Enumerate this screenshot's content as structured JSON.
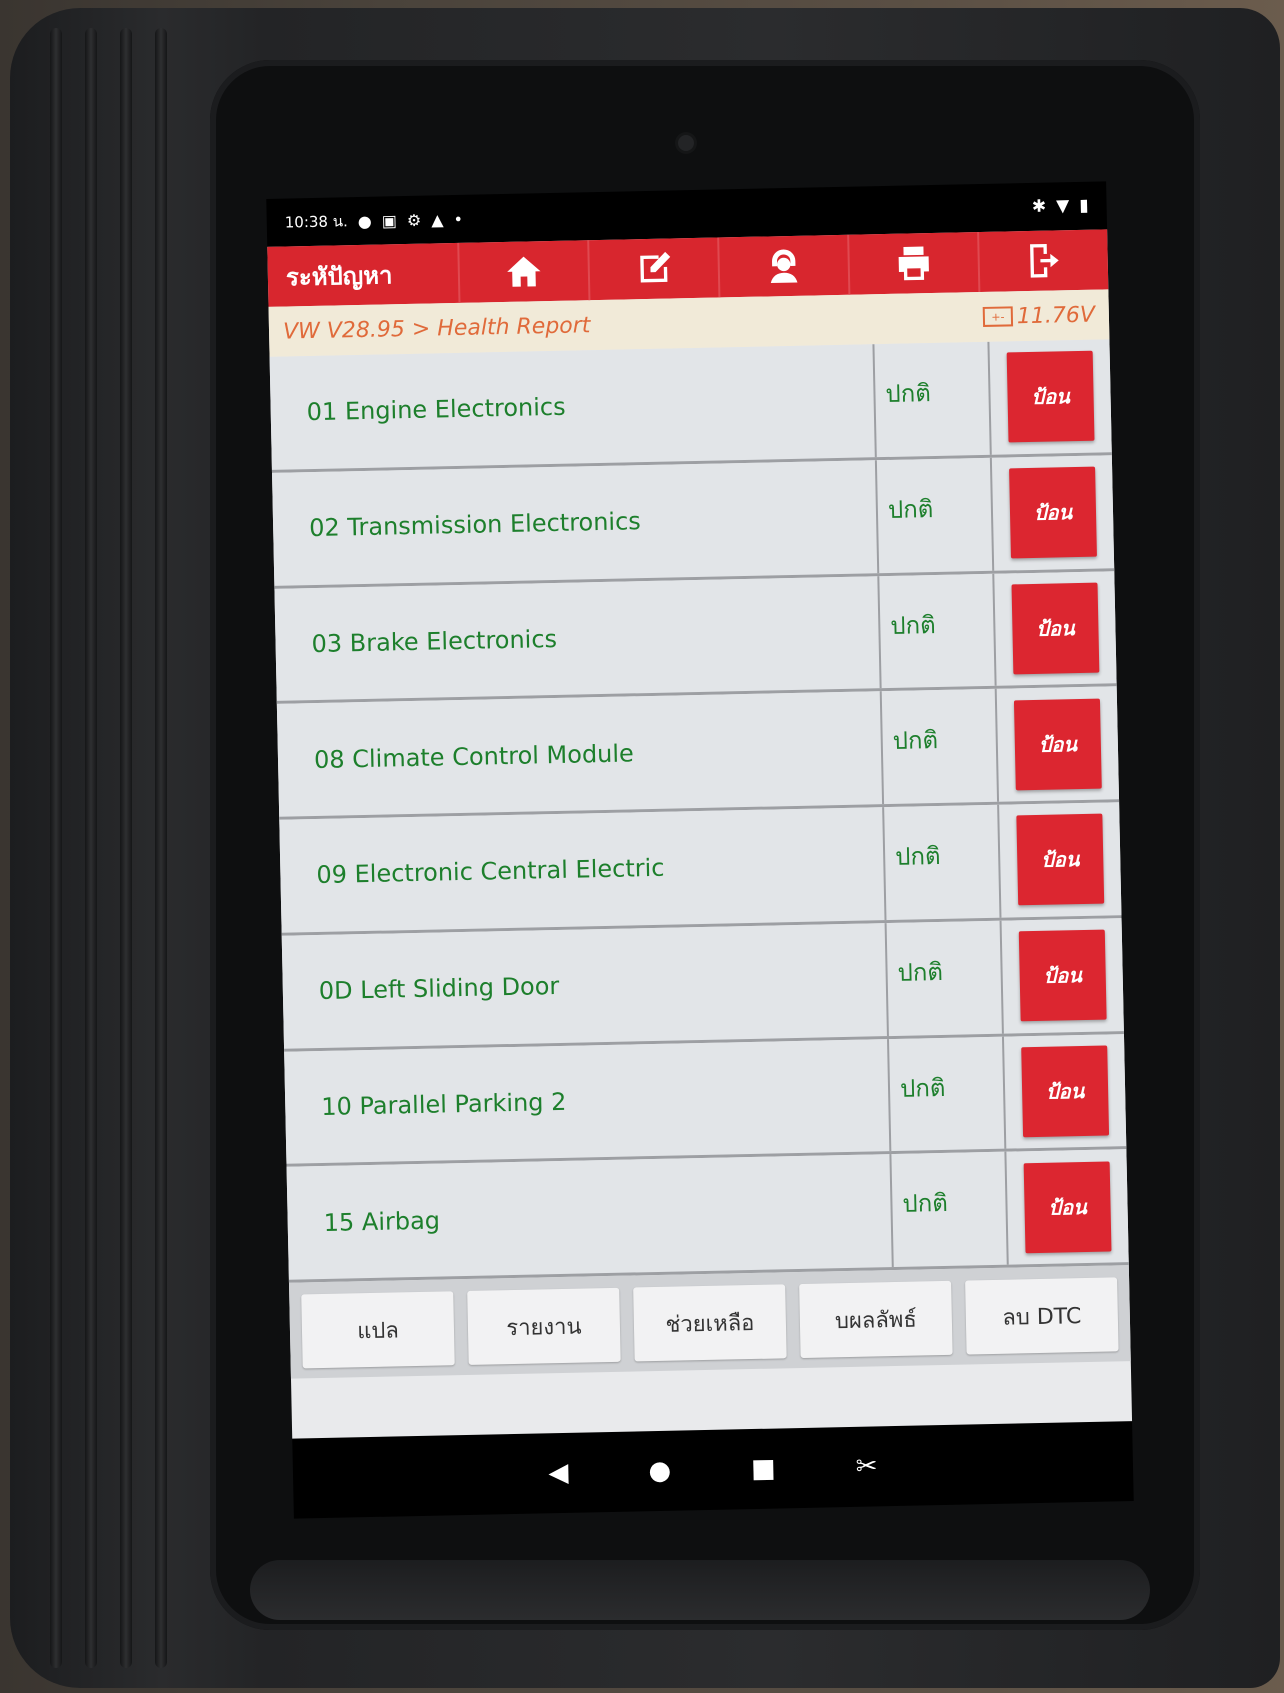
{
  "status_bar": {
    "time": "10:38 น.",
    "icons_left": [
      "circle-icon",
      "calendar-icon",
      "gear-icon",
      "warning-icon",
      "dot-icon"
    ],
    "icons_right": [
      "bluetooth-icon",
      "wifi-icon",
      "battery-icon"
    ]
  },
  "toolbar": {
    "title": "ระหัปัญหา",
    "buttons": [
      "home-icon",
      "edit-icon",
      "support-icon",
      "print-icon",
      "exit-icon"
    ]
  },
  "subbar": {
    "breadcrumb": "VW V28.95 > Health Report",
    "voltage": "11.76V",
    "battery_glyph": "+-"
  },
  "modules": [
    {
      "name": "01 Engine Electronics",
      "status": "ปกติ",
      "action": "ป้อน"
    },
    {
      "name": "02 Transmission Electronics",
      "status": "ปกติ",
      "action": "ป้อน"
    },
    {
      "name": "03 Brake Electronics",
      "status": "ปกติ",
      "action": "ป้อน"
    },
    {
      "name": "08 Climate Control Module",
      "status": "ปกติ",
      "action": "ป้อน"
    },
    {
      "name": "09 Electronic Central Electric",
      "status": "ปกติ",
      "action": "ป้อน"
    },
    {
      "name": "0D Left Sliding Door",
      "status": "ปกติ",
      "action": "ป้อน"
    },
    {
      "name": "10 Parallel Parking 2",
      "status": "ปกติ",
      "action": "ป้อน"
    },
    {
      "name": "15 Airbag",
      "status": "ปกติ",
      "action": "ป้อน"
    }
  ],
  "bottom_buttons": [
    "แปล",
    "รายงาน",
    "ช่วยเหลือ",
    "บผลลัพธ์",
    "ลบ DTC"
  ],
  "nav": [
    "back-icon",
    "home-circle-icon",
    "recents-icon",
    "screenshot-icon"
  ],
  "colors": {
    "accent": "#d8262e",
    "text_green": "#1d7f2c",
    "crumb": "#e06a3a"
  }
}
